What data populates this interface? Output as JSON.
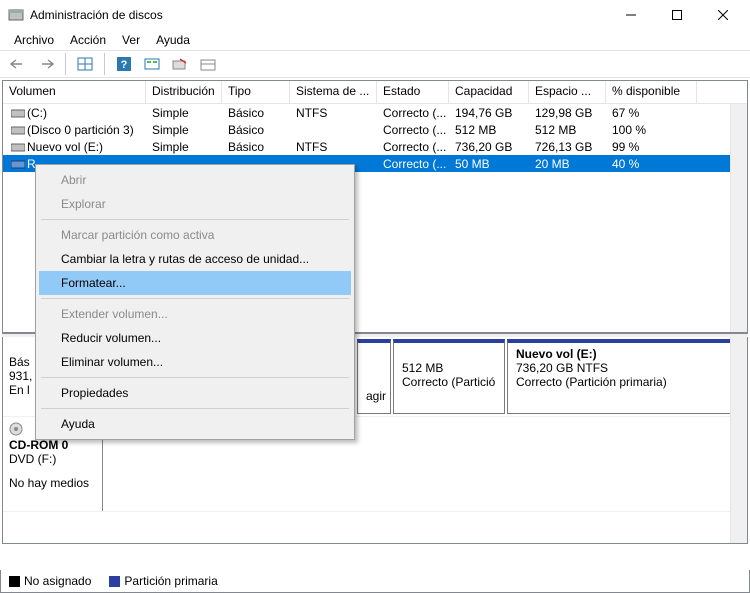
{
  "window": {
    "title": "Administración de discos"
  },
  "menu": {
    "archivo": "Archivo",
    "accion": "Acción",
    "ver": "Ver",
    "ayuda": "Ayuda"
  },
  "columns": {
    "c0": "Volumen",
    "c1": "Distribución",
    "c2": "Tipo",
    "c3": "Sistema de ...",
    "c4": "Estado",
    "c5": "Capacidad",
    "c6": "Espacio ...",
    "c7": "% disponible"
  },
  "rows": [
    {
      "vol": "(C:)",
      "dist": "Simple",
      "tipo": "Básico",
      "fs": "NTFS",
      "estado": "Correcto (...",
      "cap": "194,76 GB",
      "esp": "129,98 GB",
      "pct": "67 %"
    },
    {
      "vol": "(Disco 0 partición 3)",
      "dist": "Simple",
      "tipo": "Básico",
      "fs": "",
      "estado": "Correcto (...",
      "cap": "512 MB",
      "esp": "512 MB",
      "pct": "100 %"
    },
    {
      "vol": "Nuevo vol (E:)",
      "dist": "Simple",
      "tipo": "Básico",
      "fs": "NTFS",
      "estado": "Correcto (...",
      "cap": "736,20 GB",
      "esp": "726,13 GB",
      "pct": "99 %"
    },
    {
      "vol": "R",
      "dist": "",
      "tipo": "",
      "fs": "",
      "estado": "Correcto (...",
      "cap": "50 MB",
      "esp": "20 MB",
      "pct": "40 %"
    }
  ],
  "disk0": {
    "head0": "Bás",
    "head1": "931,",
    "head2": "En l",
    "part1_text": "agir",
    "part2_line1": "512 MB",
    "part2_line2": "Correcto (Partició",
    "part3_name": "Nuevo vol  (E:)",
    "part3_line1": "736,20 GB NTFS",
    "part3_line2": "Correcto (Partición primaria)"
  },
  "cd": {
    "name": "CD-ROM 0",
    "drive": "DVD (F:)",
    "status": "No hay medios"
  },
  "legend": {
    "unalloc": "No asignado",
    "primary": "Partición primaria"
  },
  "ctx": {
    "abrir": "Abrir",
    "explorar": "Explorar",
    "marcar": "Marcar partición como activa",
    "cambiar": "Cambiar la letra y rutas de acceso de unidad...",
    "formatear": "Formatear...",
    "extender": "Extender volumen...",
    "reducir": "Reducir volumen...",
    "eliminar": "Eliminar volumen...",
    "prop": "Propiedades",
    "ayuda": "Ayuda"
  }
}
